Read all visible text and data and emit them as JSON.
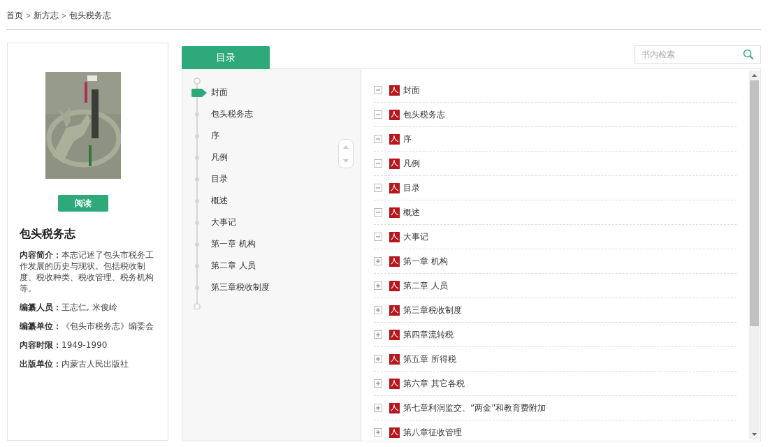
{
  "breadcrumb": [
    "首页",
    "新方志",
    "包头税务志"
  ],
  "book": {
    "read_button": "阅读",
    "title": "包头税务志",
    "fields": [
      {
        "label": "内容简介：",
        "value": "本志记述了包头市税务工作发展的历史与现状。包括税收制度、税收种类、税收管理、税务机构等。"
      },
      {
        "label": "编纂人员：",
        "value": "王志仁, 米俊岭"
      },
      {
        "label": "编纂单位：",
        "value": "《包头市税务志》编委会"
      },
      {
        "label": "内容时限：",
        "value": "1949-1990"
      },
      {
        "label": "出版单位：",
        "value": "内蒙古人民出版社"
      }
    ]
  },
  "tabs": [
    {
      "label": "目录",
      "selected": true
    }
  ],
  "search": {
    "placeholder": "书内检索"
  },
  "nav": [
    {
      "label": "封面",
      "selected": true
    },
    {
      "label": "包头税务志",
      "selected": false
    },
    {
      "label": "序",
      "selected": false
    },
    {
      "label": "凡例",
      "selected": false
    },
    {
      "label": "目录",
      "selected": false
    },
    {
      "label": "概述",
      "selected": false
    },
    {
      "label": "大事记",
      "selected": false
    },
    {
      "label": "第一章 机构",
      "selected": false
    },
    {
      "label": "第二章 人员",
      "selected": false
    },
    {
      "label": "第三章税收制度",
      "selected": false
    }
  ],
  "toc": [
    {
      "label": "封面",
      "expanded": true
    },
    {
      "label": "包头税务志",
      "expanded": true
    },
    {
      "label": "序",
      "expanded": true
    },
    {
      "label": "凡例",
      "expanded": true
    },
    {
      "label": "目录",
      "expanded": true
    },
    {
      "label": "概述",
      "expanded": true
    },
    {
      "label": "大事记",
      "expanded": true
    },
    {
      "label": "第一章 机构",
      "expanded": false
    },
    {
      "label": "第二章 人员",
      "expanded": false
    },
    {
      "label": "第三章税收制度",
      "expanded": false
    },
    {
      "label": "第四章流转税",
      "expanded": false
    },
    {
      "label": "第五章 所得税",
      "expanded": false
    },
    {
      "label": "第六章 其它各税",
      "expanded": false
    },
    {
      "label": "第七章利润监交、“两金”和教育费附加",
      "expanded": false
    },
    {
      "label": "第八章征收管理",
      "expanded": false
    }
  ]
}
